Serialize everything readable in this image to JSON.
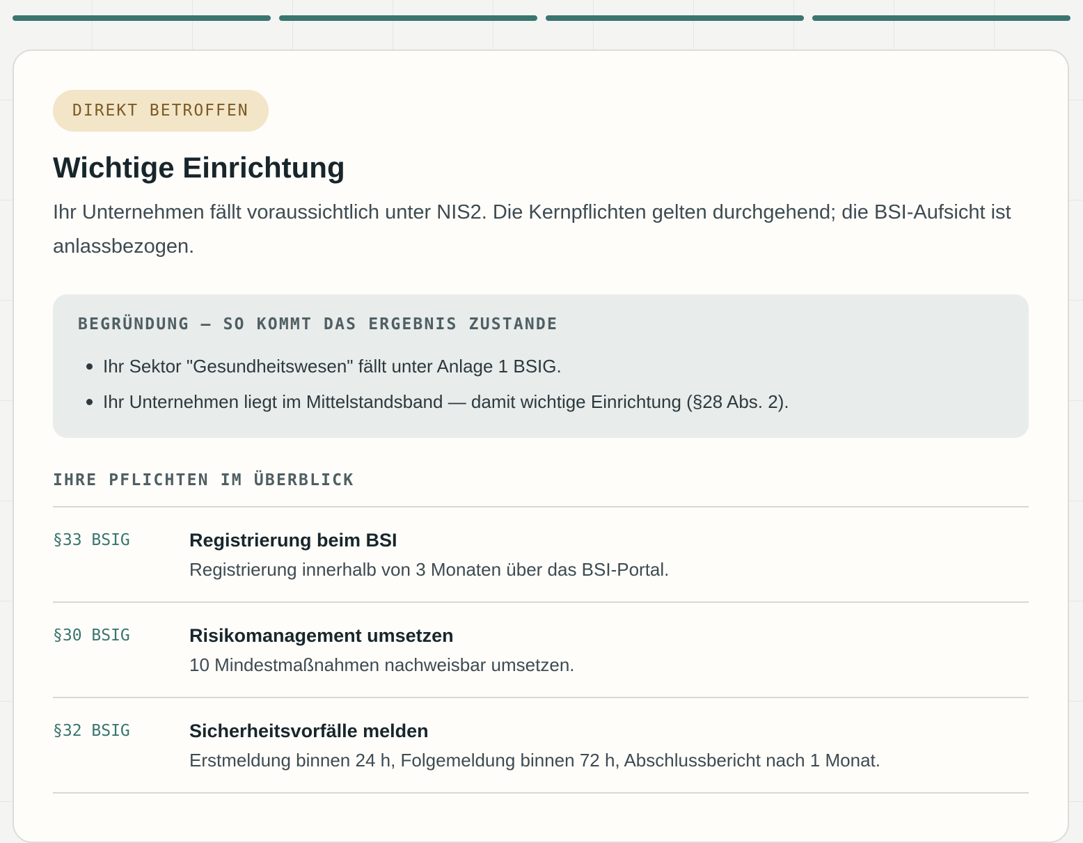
{
  "progress": {
    "steps_total": 4,
    "steps_completed": 4
  },
  "result": {
    "badge": "DIREKT BETROFFEN",
    "title": "Wichtige Einrichtung",
    "summary": "Ihr Unternehmen fällt voraussichtlich unter NIS2. Die Kernpflichten gelten durchgehend; die BSI-Aufsicht ist anlassbezogen."
  },
  "reasoning": {
    "heading": "BEGRÜNDUNG — SO KOMMT DAS ERGEBNIS ZUSTANDE",
    "items": [
      "Ihr Sektor \"Gesundheitswesen\" fällt unter Anlage 1 BSIG.",
      "Ihr Unternehmen liegt im Mittelstandsband — damit wichtige Einrichtung (§28 Abs. 2)."
    ]
  },
  "duties": {
    "heading": "IHRE PFLICHTEN IM ÜBERBLICK",
    "items": [
      {
        "ref": "§33 BSIG",
        "title": "Registrierung beim BSI",
        "desc": "Registrierung innerhalb von 3 Monaten über das BSI-Portal."
      },
      {
        "ref": "§30 BSIG",
        "title": "Risikomanagement umsetzen",
        "desc": "10 Mindestmaßnahmen nachweisbar umsetzen."
      },
      {
        "ref": "§32 BSIG",
        "title": "Sicherheitsvorfälle melden",
        "desc": "Erstmeldung binnen 24 h, Folgemeldung binnen 72 h, Abschlussbericht nach 1 Monat."
      }
    ]
  },
  "colors": {
    "accent": "#3a756f",
    "badge_bg": "#f2e5c8",
    "badge_text": "#7c5a24"
  }
}
